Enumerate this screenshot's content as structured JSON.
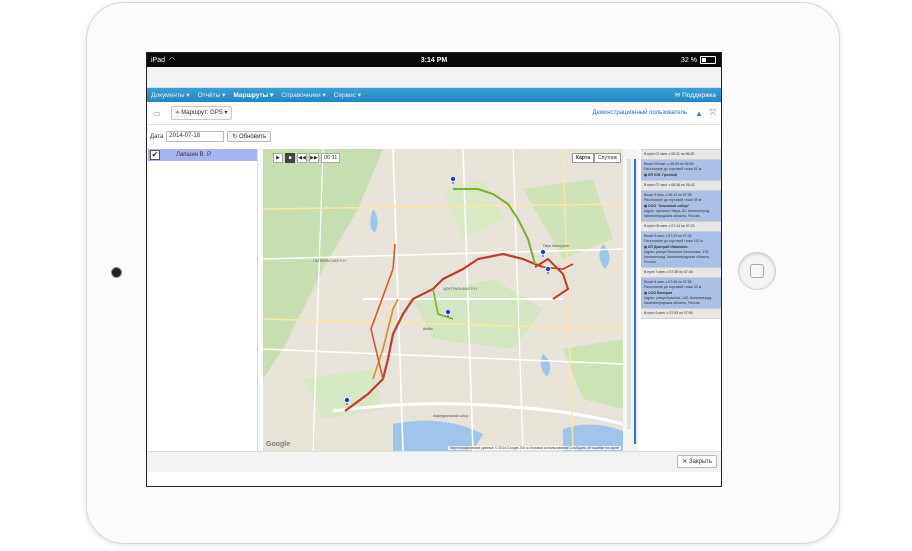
{
  "status": {
    "device": "iPad",
    "time": "3:14 PM",
    "battery": "32 %",
    "battery_level": 0.32
  },
  "menu": {
    "items": [
      {
        "label": "Документы",
        "arrow": "▾"
      },
      {
        "label": "Отчёты",
        "arrow": "▾"
      },
      {
        "label": "Маршруты",
        "arrow": "▾",
        "active": true
      },
      {
        "label": "Справочники",
        "arrow": "▾"
      },
      {
        "label": "Сервис",
        "arrow": "▾"
      }
    ],
    "support": "Поддержка"
  },
  "toolbar": {
    "route_button": "Маршрут: GPS",
    "demo_user": "Демонстрационный пользователь"
  },
  "filter": {
    "date_label": "Дата",
    "date_value": "2014-07-18",
    "refresh": "Обновить"
  },
  "drivers": [
    {
      "name": "Лапшин В. Р.",
      "checked": true
    }
  ],
  "map": {
    "time": "06:11",
    "type_map": "Карта",
    "type_sat": "Спутник",
    "google": "Google",
    "attribution": "Картографические данные © 2014 Google   200 м   Условия использования   Сообщить об ошибке на карте"
  },
  "stops": [
    {
      "head": "В пути 07 мин. с 06:11 по 06:20"
    },
    {
      "visit": "Визит 09 мин. с 06:20 по 06:36",
      "distance": "Расстояние до торговой точки 61 м",
      "org": "ИП И.В. Грозный",
      "address": ""
    },
    {
      "head": "В пути 07 мин. с 06:36 по 06:43"
    },
    {
      "visit": "Визит 9 мин. с 06:43 по 07:05",
      "distance": "Расстояние до торговой точки 35 м",
      "org": "ООО \"Земляной собор\"",
      "address": "Адрес: проспект Мира, 81, Калининград, Калининградская область, Россия"
    },
    {
      "head": "В пути 09 мин. с 07:14 по 07:23"
    },
    {
      "visit": "Визит 9 мин. с 07:23 по 07:32",
      "distance": "Расстояние до торговой точки 112 м",
      "org": "ИП Дмитрий Иванович",
      "address": "Адрес: улица Генерала Челнокова, 178, Калининград, Калининградская область, Россия"
    },
    {
      "head": "В пути 7 мин. с 07:38 по 07:45"
    },
    {
      "visit": "Визит 8 мин. с 07:45 по 07:53",
      "distance": "Расстояние до торговой точки 33 м",
      "org": "ООО Валерия",
      "address": "Адрес: улица Красная, 143, Калининград, Калининградская область, Россия"
    },
    {
      "head": "В пути 6 мин. с 07:53 по 07:59"
    }
  ],
  "bottom": {
    "close": "Закрыть"
  }
}
